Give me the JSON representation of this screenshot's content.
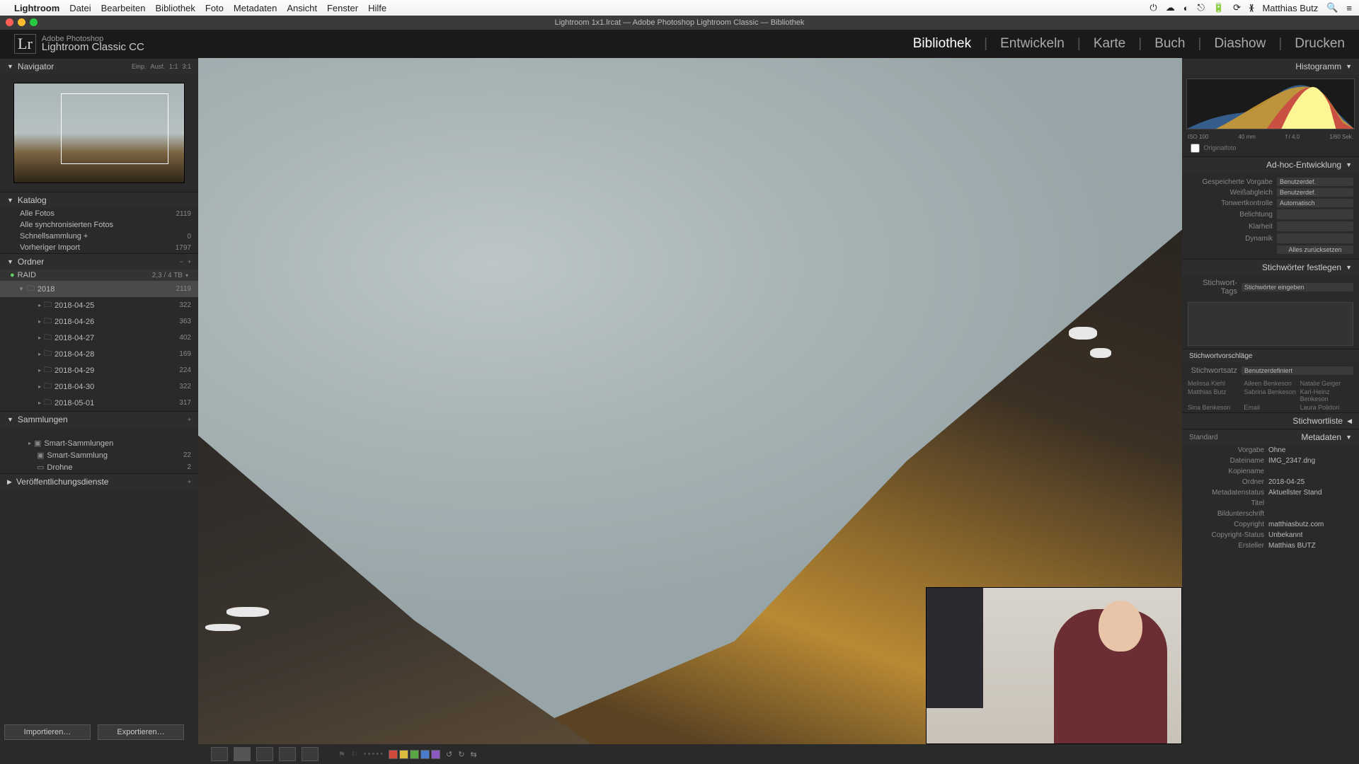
{
  "menubar": {
    "app": "Lightroom",
    "items": [
      "Datei",
      "Bearbeiten",
      "Bibliothek",
      "Foto",
      "Metadaten",
      "Ansicht",
      "Fenster",
      "Hilfe"
    ],
    "user": "Matthias Butz"
  },
  "window": {
    "title": "Lightroom 1x1.lrcat — Adobe Photoshop Lightroom Classic — Bibliothek"
  },
  "identity": {
    "vendor": "Adobe Photoshop",
    "product": "Lightroom Classic CC"
  },
  "modules": [
    "Bibliothek",
    "Entwickeln",
    "Karte",
    "Buch",
    "Diashow",
    "Drucken"
  ],
  "active_module": "Bibliothek",
  "left": {
    "navigator": {
      "title": "Navigator",
      "modes": [
        "Einp.",
        "Ausf.",
        "1:1",
        "3:1"
      ]
    },
    "catalog": {
      "title": "Katalog",
      "rows": [
        {
          "label": "Alle Fotos",
          "count": "2119"
        },
        {
          "label": "Alle synchronisierten Fotos",
          "count": ""
        },
        {
          "label": "Schnellsammlung  +",
          "count": "0"
        },
        {
          "label": "Vorheriger Import",
          "count": "1797"
        }
      ]
    },
    "folders": {
      "title": "Ordner",
      "volume": {
        "name": "RAID",
        "stat": "2,3 / 4 TB"
      },
      "year": {
        "name": "2018",
        "count": "2119"
      },
      "dates": [
        {
          "d": "2018-04-25",
          "c": "322"
        },
        {
          "d": "2018-04-26",
          "c": "363"
        },
        {
          "d": "2018-04-27",
          "c": "402"
        },
        {
          "d": "2018-04-28",
          "c": "169"
        },
        {
          "d": "2018-04-29",
          "c": "224"
        },
        {
          "d": "2018-04-30",
          "c": "322"
        },
        {
          "d": "2018-05-01",
          "c": "317"
        }
      ]
    },
    "collections": {
      "title": "Sammlungen",
      "rows": [
        {
          "label": "Smart-Sammlungen",
          "count": ""
        },
        {
          "label": "Smart-Sammlung",
          "count": "22"
        },
        {
          "label": "Drohne",
          "count": "2"
        }
      ]
    },
    "publish": {
      "title": "Veröffentlichungsdienste"
    }
  },
  "right": {
    "histogram": {
      "title": "Histogramm",
      "info": {
        "iso": "ISO 100",
        "focal": "40 mm",
        "ap": "f / 4,0",
        "exp": "1/60 Sek."
      },
      "orig": "Originalfoto"
    },
    "quickdev": {
      "title": "Ad-hoc-Entwicklung",
      "preset_label": "Gespeicherte Vorgabe",
      "preset_val": "Benutzerdef.",
      "wb_label": "Weißabgleich",
      "wb_val": "Benutzerdef.",
      "tone_label": "Tonwertkontrolle",
      "tone_val": "Automatisch",
      "exp": "Belichtung",
      "cla": "Klarheit",
      "dyn": "Dynamik",
      "reset": "Alles zurücksetzen"
    },
    "keywords": {
      "title": "Stichwörter festlegen",
      "tags_label": "Stichwort-Tags",
      "tags_ph": "Stichwörter eingeben",
      "sugg_title": "Stichwortvorschläge",
      "set_label": "Stichwortsatz",
      "set_val": "Benutzerdefiniert",
      "sugg": [
        "Melissa Kiehl",
        "Aileen Benkeson",
        "Natalie Geiger",
        "Matthias Butz",
        "Sabrina Benkeson",
        "Karl-Heinz Benkeson",
        "Sina Benkeson",
        "Email",
        "Laura Polidori"
      ]
    },
    "kwlist": {
      "title": "Stichwortliste"
    },
    "metadata": {
      "title": "Metadaten",
      "std": "Standard",
      "rows": [
        {
          "l": "Vorgabe",
          "v": "Ohne"
        },
        {
          "l": "Dateiname",
          "v": "IMG_2347.dng"
        },
        {
          "l": "Kopiename",
          "v": ""
        },
        {
          "l": "Ordner",
          "v": "2018-04-25"
        },
        {
          "l": "Metadatenstatus",
          "v": "Aktuellster Stand"
        },
        {
          "l": "Titel",
          "v": ""
        },
        {
          "l": "Bildunterschrift",
          "v": ""
        },
        {
          "l": "Copyright",
          "v": "matthiasbutz.com"
        },
        {
          "l": "Copyright-Status",
          "v": "Unbekannt"
        },
        {
          "l": "Ersteller",
          "v": "Matthias BUTZ"
        }
      ]
    }
  },
  "toolbar": {
    "import": "Importieren…",
    "export": "Exportieren…"
  },
  "colors": {
    "red": "#d24a3e",
    "yellow": "#d9b93e",
    "green": "#5aa746",
    "blue": "#4a7bc8",
    "purple": "#8a5ac0"
  }
}
